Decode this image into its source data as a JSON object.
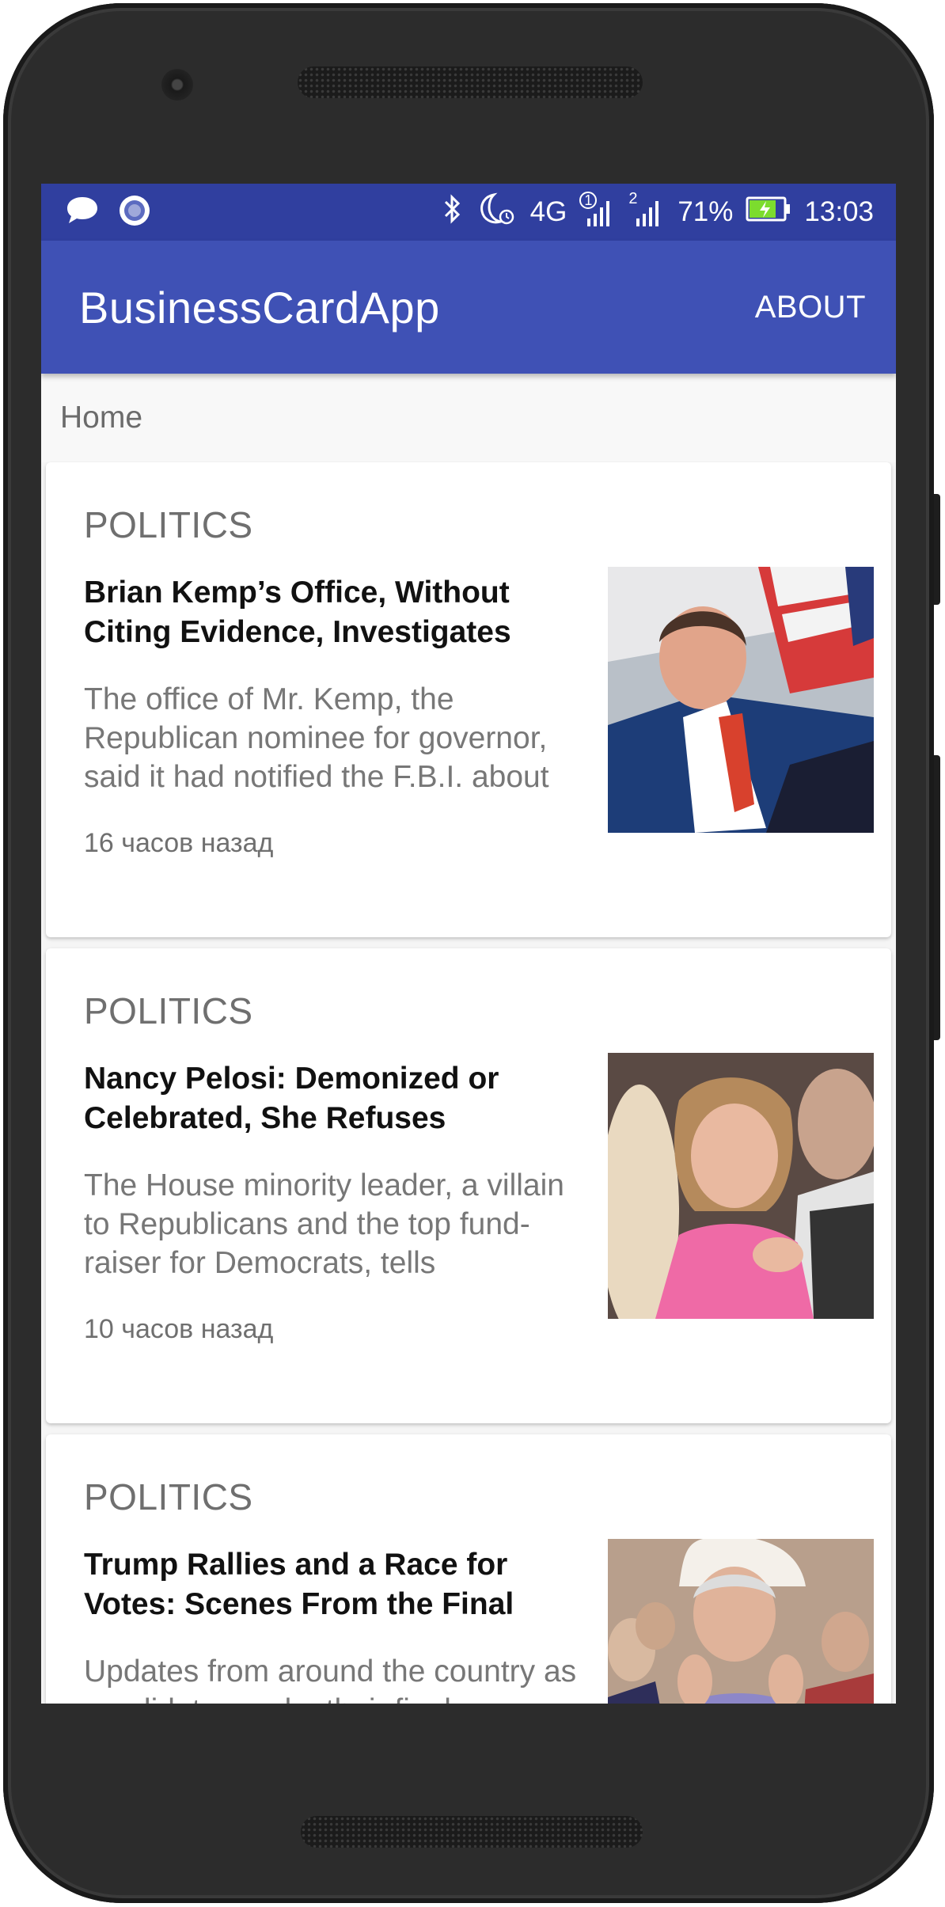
{
  "status_bar": {
    "battery": "71%",
    "time": "13:03",
    "network": "4G",
    "sim1": "1",
    "sim2": "2",
    "icons": [
      "message-icon",
      "circle-icon",
      "bluetooth-icon",
      "night-alarm-icon",
      "signal-icon",
      "battery-charging-icon"
    ]
  },
  "app_bar": {
    "title": "BusinessCardApp",
    "about_label": "ABOUT"
  },
  "breadcrumb": {
    "label": "Home"
  },
  "articles": [
    {
      "section": "POLITICS",
      "headline": "Brian Kemp’s Office, Without Citing Evidence, Investigates",
      "summary": "The office of Mr. Kemp, the Republican nominee for governor, said it had notified the F.B.I. about",
      "time": "16 часов назад"
    },
    {
      "section": "POLITICS",
      "headline": "Nancy Pelosi: Demonized or Celebrated, She Refuses",
      "summary": "The House minority leader, a villain to Republicans and the top fund-raiser for Democrats, tells",
      "time": "10 часов назад"
    },
    {
      "section": "POLITICS",
      "headline": "Trump Rallies and a Race for Votes: Scenes From the Final",
      "summary": "Updates from around the country as candidates make their final",
      "time": ""
    }
  ],
  "colors": {
    "status_bar": "#303f9f",
    "app_bar": "#3f51b5",
    "battery_fill": "#7cdc2e"
  }
}
